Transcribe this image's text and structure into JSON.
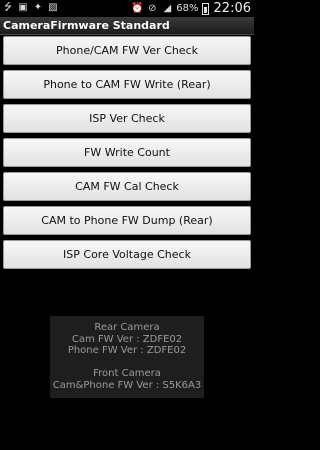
{
  "status_bar": {
    "icons_left": [
      "usb-icon",
      "camera-icon",
      "bug-icon",
      "image-icon"
    ],
    "icons_right": [
      "alarm-icon",
      "silent-icon",
      "signal-icon"
    ],
    "battery_percent": "68%",
    "battery_level": 0.68,
    "time": "22:06"
  },
  "app": {
    "title": "CameraFirmware Standard"
  },
  "buttons": [
    {
      "label": "Phone/CAM FW Ver Check"
    },
    {
      "label": "Phone to CAM FW Write (Rear)"
    },
    {
      "label": "ISP Ver Check"
    },
    {
      "label": "FW Write Count"
    },
    {
      "label": "CAM FW Cal Check"
    },
    {
      "label": "CAM to Phone FW Dump (Rear)"
    },
    {
      "label": "ISP Core Voltage Check"
    }
  ],
  "info": {
    "rear_heading": "Rear Camera",
    "rear_cam_fw": "Cam FW Ver : ZDFE02",
    "rear_phone_fw": "Phone FW Ver : ZDFE02",
    "front_heading": "Front Camera",
    "front_fw": "Cam&Phone FW Ver : S5K6A3"
  }
}
